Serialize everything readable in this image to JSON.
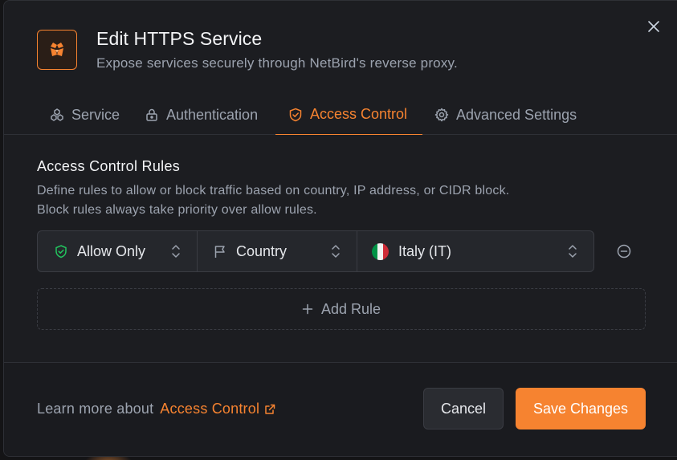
{
  "dialog": {
    "title": "Edit HTTPS Service",
    "subtitle": "Expose services securely through NetBird's reverse proxy.",
    "logo_icon": "netbird-logo-icon",
    "close_icon": "close-icon"
  },
  "tabs": [
    {
      "label": "Service",
      "icon": "service-icon",
      "active": false
    },
    {
      "label": "Authentication",
      "icon": "lock-icon",
      "active": false
    },
    {
      "label": "Access Control",
      "icon": "shield-icon",
      "active": true
    },
    {
      "label": "Advanced Settings",
      "icon": "gear-icon",
      "active": false
    }
  ],
  "access_control": {
    "title": "Access Control Rules",
    "description_line1": "Define rules to allow or block traffic based on country, IP address, or CIDR block.",
    "description_line2": "Block rules always take priority over allow rules.",
    "rules": [
      {
        "action": "Allow Only",
        "type": "Country",
        "value": "Italy (IT)"
      }
    ],
    "add_rule_label": "Add Rule"
  },
  "footer": {
    "learn_more_text": "Learn more about",
    "learn_more_link": "Access Control",
    "cancel_label": "Cancel",
    "save_label": "Save Changes"
  },
  "colors": {
    "accent": "#f68330",
    "allow_green": "#22c55e",
    "flag_green": "#009246",
    "flag_white": "#f1f2f1",
    "flag_red": "#ce2b37"
  }
}
